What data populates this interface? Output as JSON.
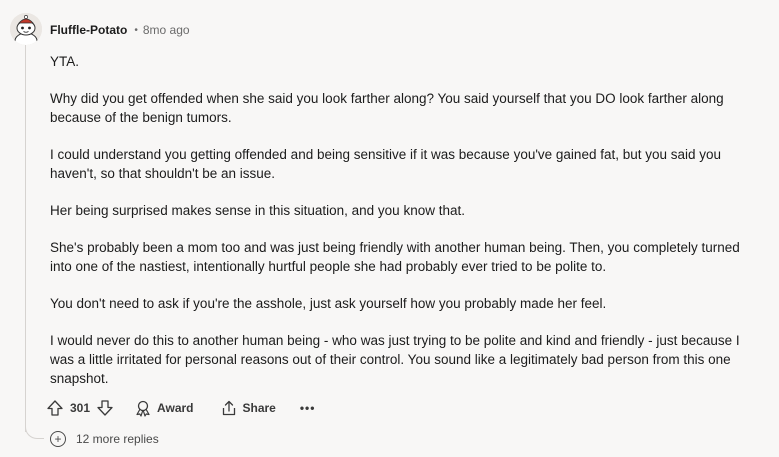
{
  "comment": {
    "username": "Fluffle-Potato",
    "separator": "•",
    "time_ago": "8mo ago",
    "paragraphs": [
      "YTA.",
      "Why did you get offended when she said you look farther along? You said yourself that you DO look farther along because of the benign tumors.",
      "I could understand you getting offended and being sensitive if it was because you've gained fat, but you said you haven't, so that shouldn't be an issue.",
      "Her being surprised makes sense in this situation, and you know that.",
      "She's probably been a mom too and was just being friendly with another human being. Then, you completely turned into one of the nastiest, intentionally hurtful people she had probably ever tried to be polite to.",
      "You don't need to ask if you're the asshole, just ask yourself how you probably made her feel.",
      "I would never do this to another human being - who was just trying to be polite and kind and friendly - just because I was a little irritated for personal reasons out of their control. You sound like a legitimately bad person from this one snapshot."
    ]
  },
  "actions": {
    "score": "301",
    "award_label": "Award",
    "share_label": "Share",
    "more_label": "•••"
  },
  "replies": {
    "plus": "+",
    "label": "12 more replies"
  },
  "icons": {
    "upvote": "upvote-arrow-icon",
    "downvote": "downvote-arrow-icon",
    "award": "award-ribbon-icon",
    "share": "share-arrow-icon",
    "more": "more-dots-icon",
    "expand": "plus-circle-icon"
  }
}
